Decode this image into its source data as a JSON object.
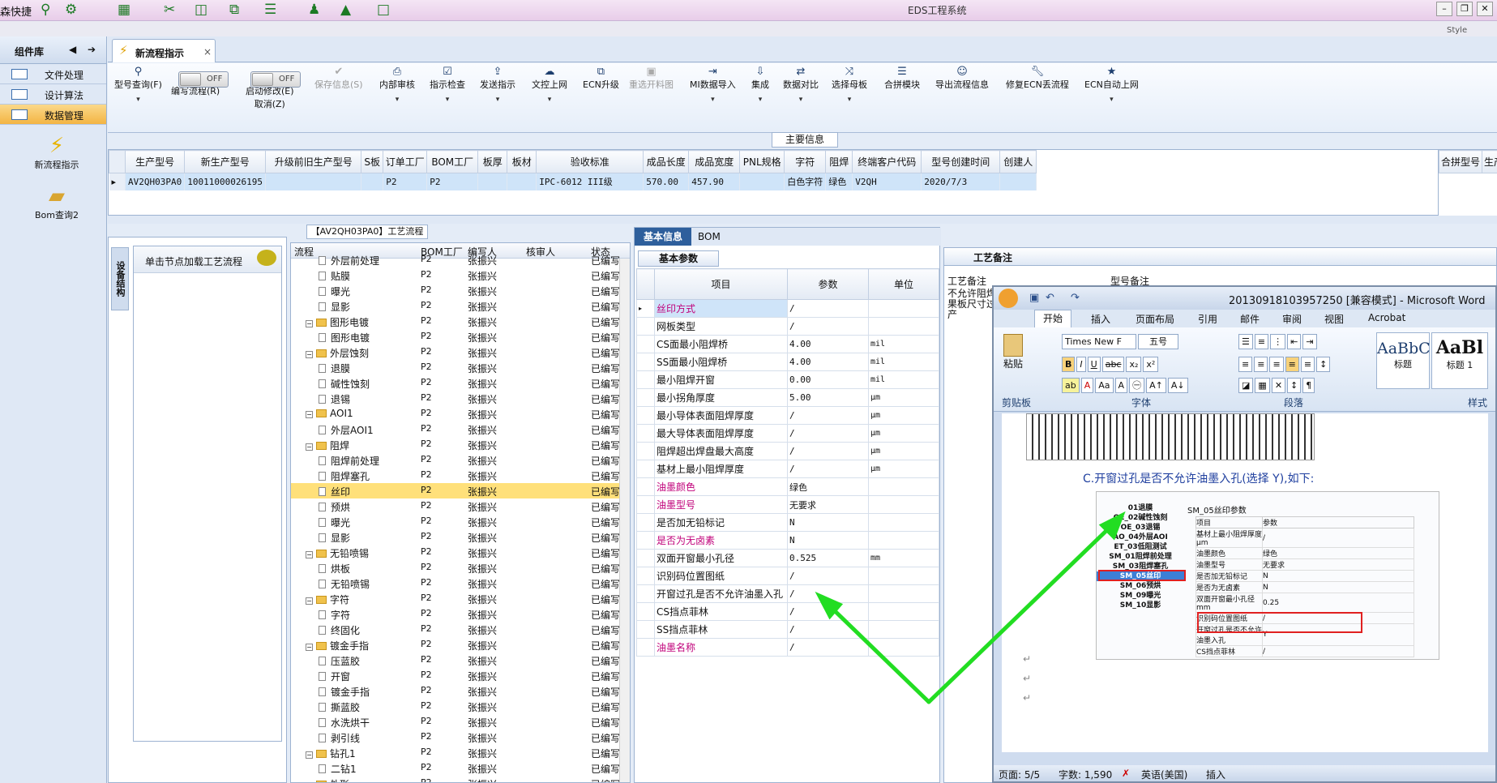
{
  "app": {
    "window_title": "EDS工程系统",
    "quick_access_label": "森快捷",
    "style_label": "Style"
  },
  "left_nav": {
    "title": "组件库",
    "items": [
      {
        "label": "文件处理"
      },
      {
        "label": "设计算法"
      },
      {
        "label": "数据管理"
      }
    ],
    "quick_items": [
      {
        "label": "新流程指示"
      },
      {
        "label": "Bom查询2"
      }
    ]
  },
  "tab": {
    "label": "新流程指示",
    "close": "×"
  },
  "toolbar": {
    "buttons": [
      {
        "label": "型号查询(F)",
        "icon": "search-icon"
      },
      {
        "label": "编写流程(R)",
        "icon": "toggle-switch"
      },
      {
        "label": "启动修改(E)",
        "label2": "取消(Z)",
        "icon": "toggle-switch"
      },
      {
        "label": "保存信息(S)",
        "icon": "check-icon",
        "disabled": true
      },
      {
        "label": "内部审核",
        "icon": "print-icon"
      },
      {
        "label": "指示检查",
        "icon": "checkbox-icon"
      },
      {
        "label": "发送指示",
        "icon": "upload-icon"
      },
      {
        "label": "文控上网",
        "icon": "cloud-upload-icon"
      },
      {
        "label": "ECN升级",
        "icon": "binoculars-icon"
      },
      {
        "label": "重选开料图",
        "icon": "image-icon",
        "disabled": true
      },
      {
        "label": "MI数据导入",
        "icon": "import-icon"
      },
      {
        "label": "集成",
        "icon": "download-icon"
      },
      {
        "label": "数据对比",
        "icon": "compare-icon"
      },
      {
        "label": "选择母板",
        "icon": "shuffle-icon"
      },
      {
        "label": "合拼模块",
        "icon": "list-icon"
      },
      {
        "label": "导出流程信息",
        "icon": "smile-icon"
      },
      {
        "label": "修复ECN丢流程",
        "icon": "wrench-icon"
      },
      {
        "label": "ECN自动上网",
        "icon": "star-icon"
      }
    ],
    "toggle_state": "OFF"
  },
  "main_info": {
    "label": "主要信息",
    "columns": [
      "生产型号",
      "新生产型号",
      "升级前旧生产型号",
      "S板",
      "订单工厂",
      "BOM工厂",
      "板厚",
      "板材",
      "验收标准",
      "成品长度",
      "成品宽度",
      "PNL规格",
      "字符",
      "阻焊",
      "终端客户代码",
      "型号创建时间",
      "创建人"
    ],
    "row": [
      "AV2QH03PA0",
      "10011000026195",
      "",
      "",
      "P2",
      "P2",
      "",
      "",
      "IPC-6012 III级",
      "570.00",
      "457.90",
      "",
      "白色字符",
      "绿色",
      "V2QH",
      "2020/7/3",
      ""
    ],
    "merge_columns": [
      "合拼型号",
      "生产型号"
    ]
  },
  "process": {
    "title": "【AV2QH03PA0】工艺流程",
    "vertical_tab": "设备结构",
    "hint": "单击节点加载工艺流程",
    "columns": [
      "流程",
      "BOM工厂",
      "编写人",
      "核审人",
      "状态"
    ],
    "rows": [
      {
        "name": "外层前处理",
        "level": 2,
        "type": "leaf",
        "factory": "P2",
        "writer": "张振兴",
        "status": "已编写"
      },
      {
        "name": "贴膜",
        "level": 2,
        "type": "leaf",
        "factory": "P2",
        "writer": "张振兴",
        "status": "已编写"
      },
      {
        "name": "曝光",
        "level": 2,
        "type": "leaf",
        "factory": "P2",
        "writer": "张振兴",
        "status": "已编写"
      },
      {
        "name": "显影",
        "level": 2,
        "type": "leaf",
        "factory": "P2",
        "writer": "张振兴",
        "status": "已编写"
      },
      {
        "name": "图形电镀",
        "level": 1,
        "type": "folder",
        "factory": "P2",
        "writer": "张振兴",
        "status": "已编写"
      },
      {
        "name": "图形电镀",
        "level": 2,
        "type": "leaf",
        "factory": "P2",
        "writer": "张振兴",
        "status": "已编写"
      },
      {
        "name": "外层蚀刻",
        "level": 1,
        "type": "folder",
        "factory": "P2",
        "writer": "张振兴",
        "status": "已编写"
      },
      {
        "name": "退膜",
        "level": 2,
        "type": "leaf",
        "factory": "P2",
        "writer": "张振兴",
        "status": "已编写"
      },
      {
        "name": "碱性蚀刻",
        "level": 2,
        "type": "leaf",
        "factory": "P2",
        "writer": "张振兴",
        "status": "已编写"
      },
      {
        "name": "退锡",
        "level": 2,
        "type": "leaf",
        "factory": "P2",
        "writer": "张振兴",
        "status": "已编写"
      },
      {
        "name": "AOI1",
        "level": 1,
        "type": "folder",
        "factory": "P2",
        "writer": "张振兴",
        "status": "已编写"
      },
      {
        "name": "外层AOI1",
        "level": 2,
        "type": "leaf",
        "factory": "P2",
        "writer": "张振兴",
        "status": "已编写"
      },
      {
        "name": "阻焊",
        "level": 1,
        "type": "folder",
        "factory": "P2",
        "writer": "张振兴",
        "status": "已编写"
      },
      {
        "name": "阻焊前处理",
        "level": 2,
        "type": "leaf",
        "factory": "P2",
        "writer": "张振兴",
        "status": "已编写"
      },
      {
        "name": "阻焊塞孔",
        "level": 2,
        "type": "leaf",
        "factory": "P2",
        "writer": "张振兴",
        "status": "已编写"
      },
      {
        "name": "丝印",
        "level": 2,
        "type": "leaf",
        "factory": "P2",
        "writer": "张振兴",
        "status": "已编写",
        "selected": true
      },
      {
        "name": "预烘",
        "level": 2,
        "type": "leaf",
        "factory": "P2",
        "writer": "张振兴",
        "status": "已编写"
      },
      {
        "name": "曝光",
        "level": 2,
        "type": "leaf",
        "factory": "P2",
        "writer": "张振兴",
        "status": "已编写"
      },
      {
        "name": "显影",
        "level": 2,
        "type": "leaf",
        "factory": "P2",
        "writer": "张振兴",
        "status": "已编写"
      },
      {
        "name": "无铅喷锡",
        "level": 1,
        "type": "folder",
        "factory": "P2",
        "writer": "张振兴",
        "status": "已编写"
      },
      {
        "name": "烘板",
        "level": 2,
        "type": "leaf",
        "factory": "P2",
        "writer": "张振兴",
        "status": "已编写"
      },
      {
        "name": "无铅喷锡",
        "level": 2,
        "type": "leaf",
        "factory": "P2",
        "writer": "张振兴",
        "status": "已编写"
      },
      {
        "name": "字符",
        "level": 1,
        "type": "folder",
        "factory": "P2",
        "writer": "张振兴",
        "status": "已编写"
      },
      {
        "name": "字符",
        "level": 2,
        "type": "leaf",
        "factory": "P2",
        "writer": "张振兴",
        "status": "已编写"
      },
      {
        "name": "终固化",
        "level": 2,
        "type": "leaf",
        "factory": "P2",
        "writer": "张振兴",
        "status": "已编写"
      },
      {
        "name": "镀金手指",
        "level": 1,
        "type": "folder",
        "factory": "P2",
        "writer": "张振兴",
        "status": "已编写"
      },
      {
        "name": "压蓝胶",
        "level": 2,
        "type": "leaf",
        "factory": "P2",
        "writer": "张振兴",
        "status": "已编写"
      },
      {
        "name": "开窗",
        "level": 2,
        "type": "leaf",
        "factory": "P2",
        "writer": "张振兴",
        "status": "已编写"
      },
      {
        "name": "镀金手指",
        "level": 2,
        "type": "leaf",
        "factory": "P2",
        "writer": "张振兴",
        "status": "已编写"
      },
      {
        "name": "撕蓝胶",
        "level": 2,
        "type": "leaf",
        "factory": "P2",
        "writer": "张振兴",
        "status": "已编写"
      },
      {
        "name": "水洗烘干",
        "level": 2,
        "type": "leaf",
        "factory": "P2",
        "writer": "张振兴",
        "status": "已编写"
      },
      {
        "name": "剥引线",
        "level": 2,
        "type": "leaf",
        "factory": "P2",
        "writer": "张振兴",
        "status": "已编写"
      },
      {
        "name": "钻孔1",
        "level": 1,
        "type": "folder",
        "factory": "P2",
        "writer": "张振兴",
        "status": "已编写"
      },
      {
        "name": "二钻1",
        "level": 2,
        "type": "leaf",
        "factory": "P2",
        "writer": "张振兴",
        "status": "已编写"
      },
      {
        "name": "外形",
        "level": 1,
        "type": "folder",
        "factory": "P2",
        "writer": "张振兴",
        "status": "已编写"
      }
    ]
  },
  "basic_info": {
    "tab_active": "基本信息",
    "tab_other": "BOM",
    "section": "基本参数",
    "columns": [
      "项目",
      "参数",
      "单位"
    ],
    "rows": [
      {
        "item": "丝印方式",
        "value": "/",
        "unit": "",
        "mandatory": true,
        "selected": true
      },
      {
        "item": "网板类型",
        "value": "/",
        "unit": ""
      },
      {
        "item": "CS面最小阻焊桥",
        "value": "4.00",
        "unit": "mil"
      },
      {
        "item": "SS面最小阻焊桥",
        "value": "4.00",
        "unit": "mil"
      },
      {
        "item": "最小阻焊开窗",
        "value": "0.00",
        "unit": "mil"
      },
      {
        "item": "最小拐角厚度",
        "value": "5.00",
        "unit": "μm"
      },
      {
        "item": "最小导体表面阻焊厚度",
        "value": "/",
        "unit": "μm"
      },
      {
        "item": "最大导体表面阻焊厚度",
        "value": "/",
        "unit": "μm"
      },
      {
        "item": "阻焊超出焊盘最大高度",
        "value": "/",
        "unit": "μm"
      },
      {
        "item": "基材上最小阻焊厚度",
        "value": "/",
        "unit": "μm"
      },
      {
        "item": "油墨颜色",
        "value": "绿色",
        "unit": "",
        "mandatory": true
      },
      {
        "item": "油墨型号",
        "value": "无要求",
        "unit": "",
        "mandatory": true
      },
      {
        "item": "是否加无铅标记",
        "value": "N",
        "unit": ""
      },
      {
        "item": "是否为无卤素",
        "value": "N",
        "unit": "",
        "mandatory": true
      },
      {
        "item": "双面开窗最小孔径",
        "value": "0.525",
        "unit": "mm"
      },
      {
        "item": "识别码位置图纸",
        "value": "/",
        "unit": ""
      },
      {
        "item": "开窗过孔是否不允许油墨入孔",
        "value": "/",
        "unit": ""
      },
      {
        "item": "CS挡点菲林",
        "value": "/",
        "unit": ""
      },
      {
        "item": "SS挡点菲林",
        "value": "/",
        "unit": ""
      },
      {
        "item": "油墨名称",
        "value": "/",
        "unit": "",
        "mandatory": true
      }
    ]
  },
  "remark": {
    "title": "工艺备注",
    "col1": "工艺备注",
    "col2": "型号备注",
    "text": "不允许阻焊\n果板尺寸过\n产"
  },
  "word_window": {
    "title": "20130918103957250 [兼容模式] - Microsoft Word",
    "tabs": [
      "开始",
      "插入",
      "页面布局",
      "引用",
      "邮件",
      "审阅",
      "视图",
      "Acrobat"
    ],
    "font_name": "Times New F",
    "font_size": "五号",
    "groups": [
      "剪贴板",
      "字体",
      "段落",
      "样式"
    ],
    "paste_label": "粘贴",
    "style1_preview": "AaBbC",
    "style1_label": "标题",
    "style2_preview": "AaBl",
    "style2_label": "标题 1",
    "doc_heading": "C.开窗过孔是否不允许油墨入孔(选择 Y),如下:",
    "embedded": {
      "tree_items": [
        "01退膜",
        "OE_02碱性蚀刻",
        "OE_03退锡",
        "AO_04外层AOI",
        "ET_03低阻测试",
        "SM_01阻焊前处理",
        "SM_03阻焊塞孔",
        "SM_05丝印",
        "SM_06预烘",
        "SM_09曝光",
        "SM_10显影"
      ],
      "panel_title": "SM_05丝印参数",
      "columns": [
        "项目",
        "参数"
      ],
      "rows": [
        {
          "item": "基材上最小阻焊厚度μm",
          "value": "/"
        },
        {
          "item": "油墨颜色",
          "value": "绿色"
        },
        {
          "item": "油墨型号",
          "value": "无要求"
        },
        {
          "item": "是否加无铅标记",
          "value": "N"
        },
        {
          "item": "是否为无卤素",
          "value": "N"
        },
        {
          "item": "双面开窗最小孔径mm",
          "value": "0.25"
        },
        {
          "item": "识别码位置图纸",
          "value": "/"
        },
        {
          "item": "开窗过孔是否不允许油墨入孔",
          "value": "Y"
        },
        {
          "item": "CS挡点菲林",
          "value": "/"
        }
      ]
    },
    "status": {
      "page": "页面: 5/5",
      "words": "字数: 1,590",
      "language": "英语(美国)",
      "mode": "插入"
    }
  },
  "colors": {
    "accent": "#2e5f9c",
    "selection": "#ffe07a",
    "row_highlight": "#cfe4f9",
    "mandatory_text": "#c0007a",
    "arrow": "#22dd22",
    "highlight_box": "#e02020"
  }
}
